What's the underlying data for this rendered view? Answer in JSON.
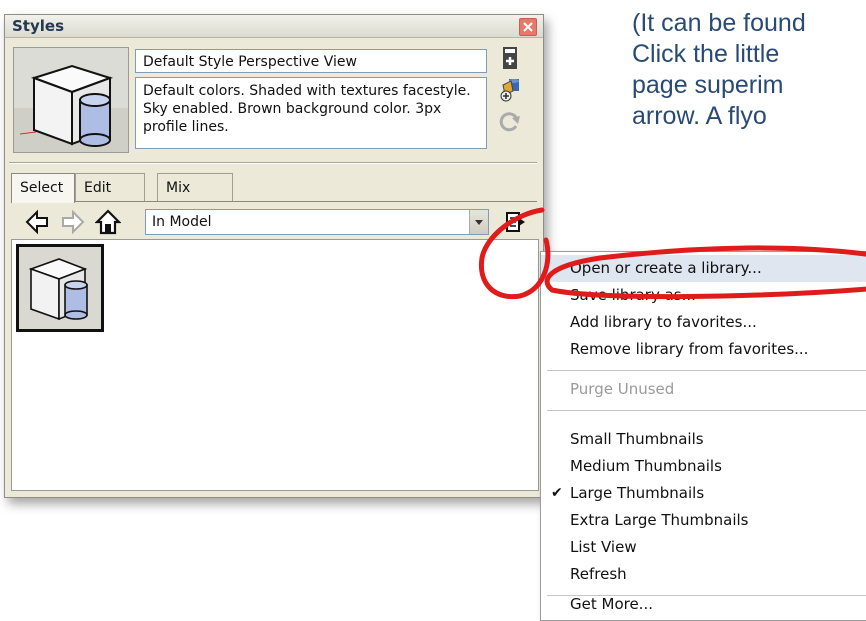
{
  "doc": {
    "lines": [
      "",
      "(It can be found",
      "Click the little",
      "page superim",
      "arrow. A flyo"
    ]
  },
  "panel": {
    "title": "Styles",
    "style_name": "Default Style Perspective View",
    "style_description": "Default colors.  Shaded with textures facestyle.  Sky enabled.  Brown background color.  3px profile lines.",
    "tabs": [
      "Select",
      "Edit",
      "Mix"
    ],
    "collection": "In Model"
  },
  "menu": {
    "items": [
      {
        "label": "Open or create a library...",
        "highlighted": true
      },
      {
        "label": "Save library as..."
      },
      {
        "label": "Add library to favorites..."
      },
      {
        "label": "Remove library from favorites..."
      },
      {
        "label": "Purge Unused",
        "disabled": true
      },
      {
        "label": "Small Thumbnails"
      },
      {
        "label": "Medium Thumbnails"
      },
      {
        "label": "Large Thumbnails",
        "checked": true
      },
      {
        "label": "Extra Large Thumbnails"
      },
      {
        "label": "List View"
      },
      {
        "label": "Refresh"
      },
      {
        "label": "Get More..."
      }
    ],
    "check_glyph": "✔"
  },
  "icons": {
    "close": "close-icon",
    "create_style": "create-style-icon",
    "update_style": "update-style-icon",
    "refresh": "refresh-icon",
    "back": "back-arrow-icon",
    "forward": "forward-arrow-icon",
    "home": "home-icon",
    "details": "details-icon"
  },
  "colors": {
    "annotation_red": "#e01b1b",
    "menu_highlight": "#dfe6f0",
    "doc_text": "#2a4a76"
  }
}
